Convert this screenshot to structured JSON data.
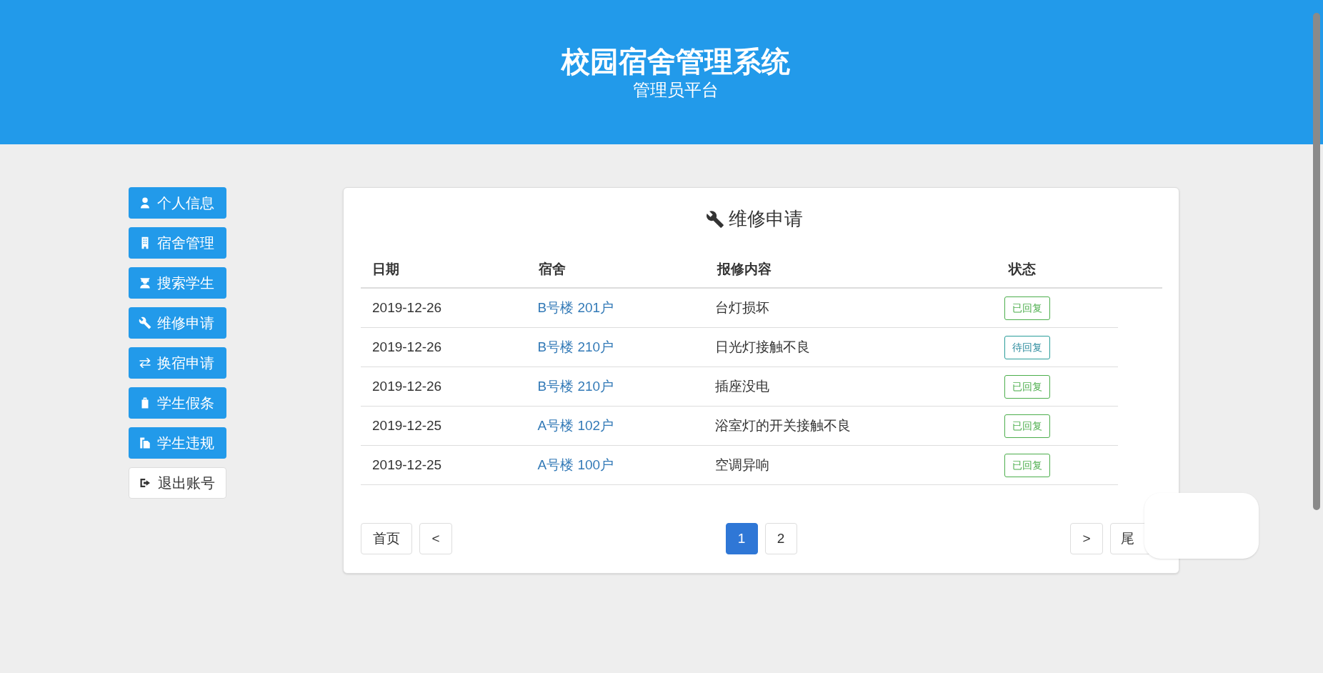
{
  "header": {
    "title": "校园宿舍管理系统",
    "subtitle": "管理员平台"
  },
  "sidebar": {
    "items": [
      {
        "label": "个人信息",
        "kind": "primary"
      },
      {
        "label": "宿舍管理",
        "kind": "primary"
      },
      {
        "label": "搜索学生",
        "kind": "primary"
      },
      {
        "label": "维修申请",
        "kind": "primary"
      },
      {
        "label": "换宿申请",
        "kind": "primary"
      },
      {
        "label": "学生假条",
        "kind": "primary"
      },
      {
        "label": "学生违规",
        "kind": "primary"
      },
      {
        "label": "退出账号",
        "kind": "plain"
      }
    ]
  },
  "panel": {
    "title": "维修申请",
    "table": {
      "columns": [
        "日期",
        "宿舍",
        "报修内容",
        "状态"
      ],
      "rows": [
        {
          "date": "2019-12-26",
          "dorm": "B号楼 201户",
          "content": "台灯损坏",
          "status": "已回复",
          "kind": "replied"
        },
        {
          "date": "2019-12-26",
          "dorm": "B号楼 210户",
          "content": "日光灯接触不良",
          "status": "待回复",
          "kind": "pending"
        },
        {
          "date": "2019-12-26",
          "dorm": "B号楼 210户",
          "content": "插座没电",
          "status": "已回复",
          "kind": "replied"
        },
        {
          "date": "2019-12-25",
          "dorm": "A号楼 102户",
          "content": "浴室灯的开关接触不良",
          "status": "已回复",
          "kind": "replied"
        },
        {
          "date": "2019-12-25",
          "dorm": "A号楼 100户",
          "content": "空调异响",
          "status": "已回复",
          "kind": "replied"
        }
      ]
    },
    "pagination": {
      "first": "首页",
      "prev": "<",
      "pages": [
        {
          "label": "1",
          "selected": true
        },
        {
          "label": "2",
          "selected": false
        }
      ],
      "next": ">",
      "last": "尾"
    }
  }
}
